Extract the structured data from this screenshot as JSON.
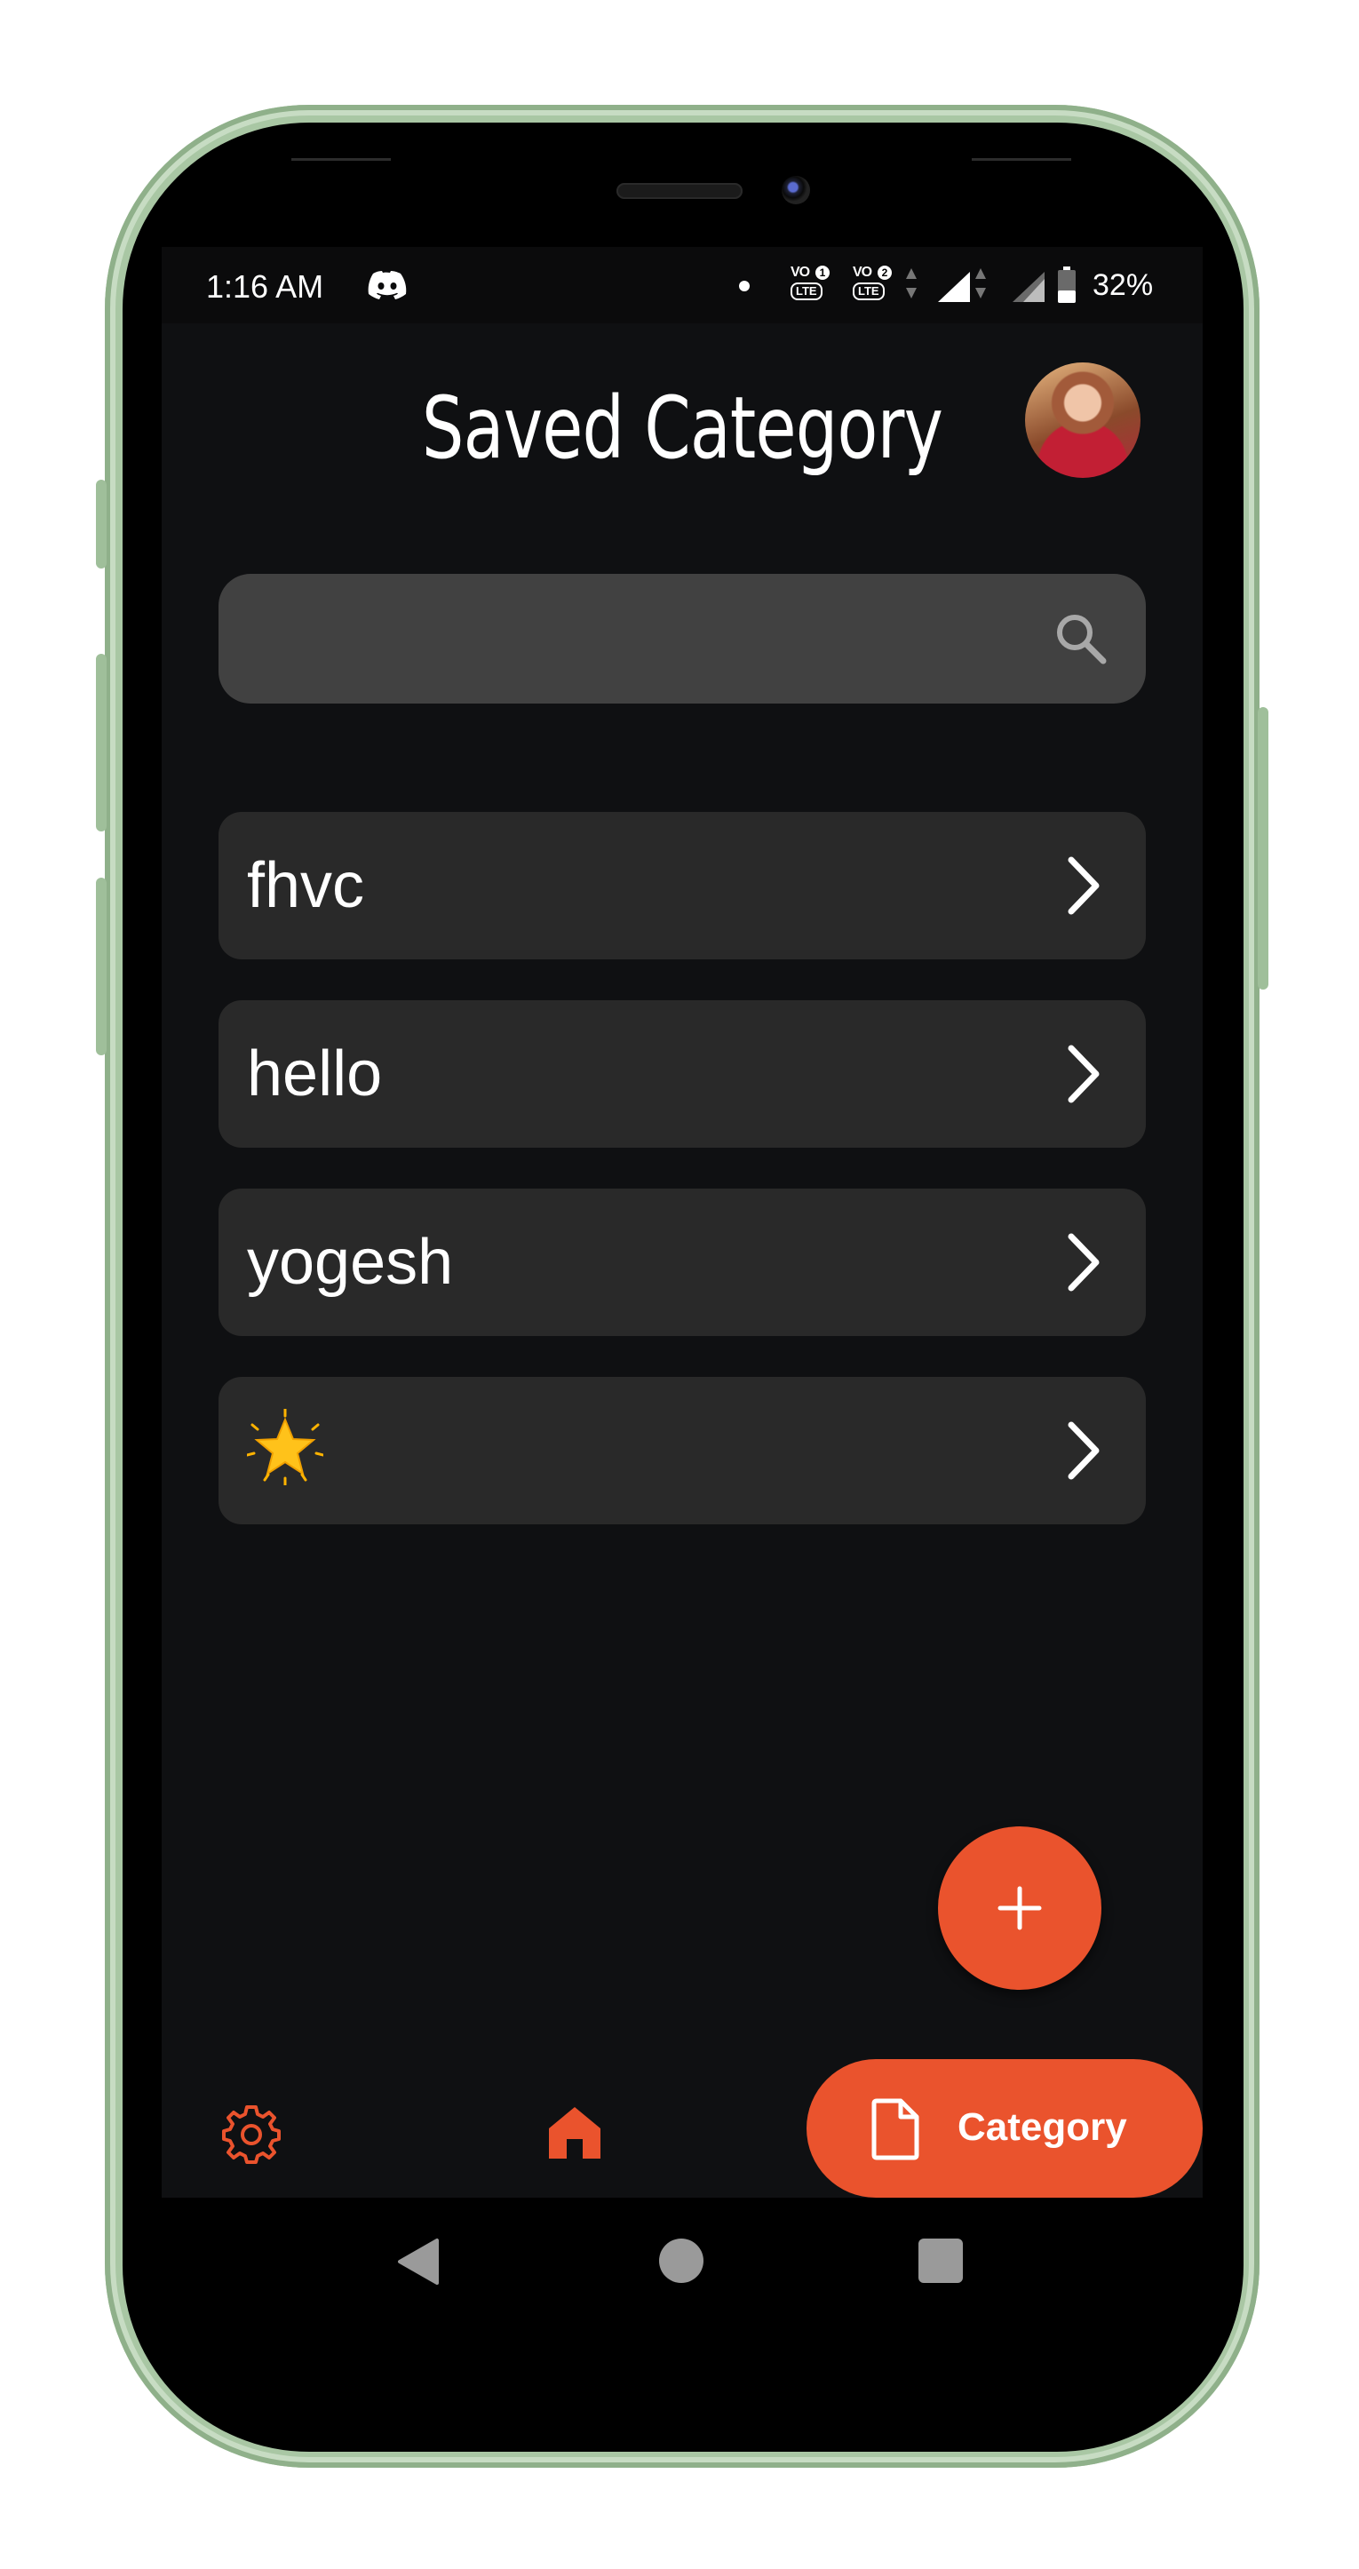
{
  "status_bar": {
    "time": "1:16 AM",
    "vo_badges": [
      {
        "top": "VO",
        "num": "1",
        "lte": "LTE"
      },
      {
        "top": "VO",
        "num": "2",
        "lte": "LTE"
      }
    ],
    "battery_percent": "32%"
  },
  "header": {
    "title": "Saved Category"
  },
  "search": {
    "value": "",
    "placeholder": ""
  },
  "categories": [
    {
      "label": "fhvc"
    },
    {
      "label": "hello"
    },
    {
      "label": "yogesh"
    },
    {
      "label": "🌟"
    }
  ],
  "bottom_nav": {
    "category_label": "Category"
  },
  "colors": {
    "accent": "#ea532d",
    "background": "#0f1012",
    "card": "#292929",
    "search_bg": "#414141"
  }
}
